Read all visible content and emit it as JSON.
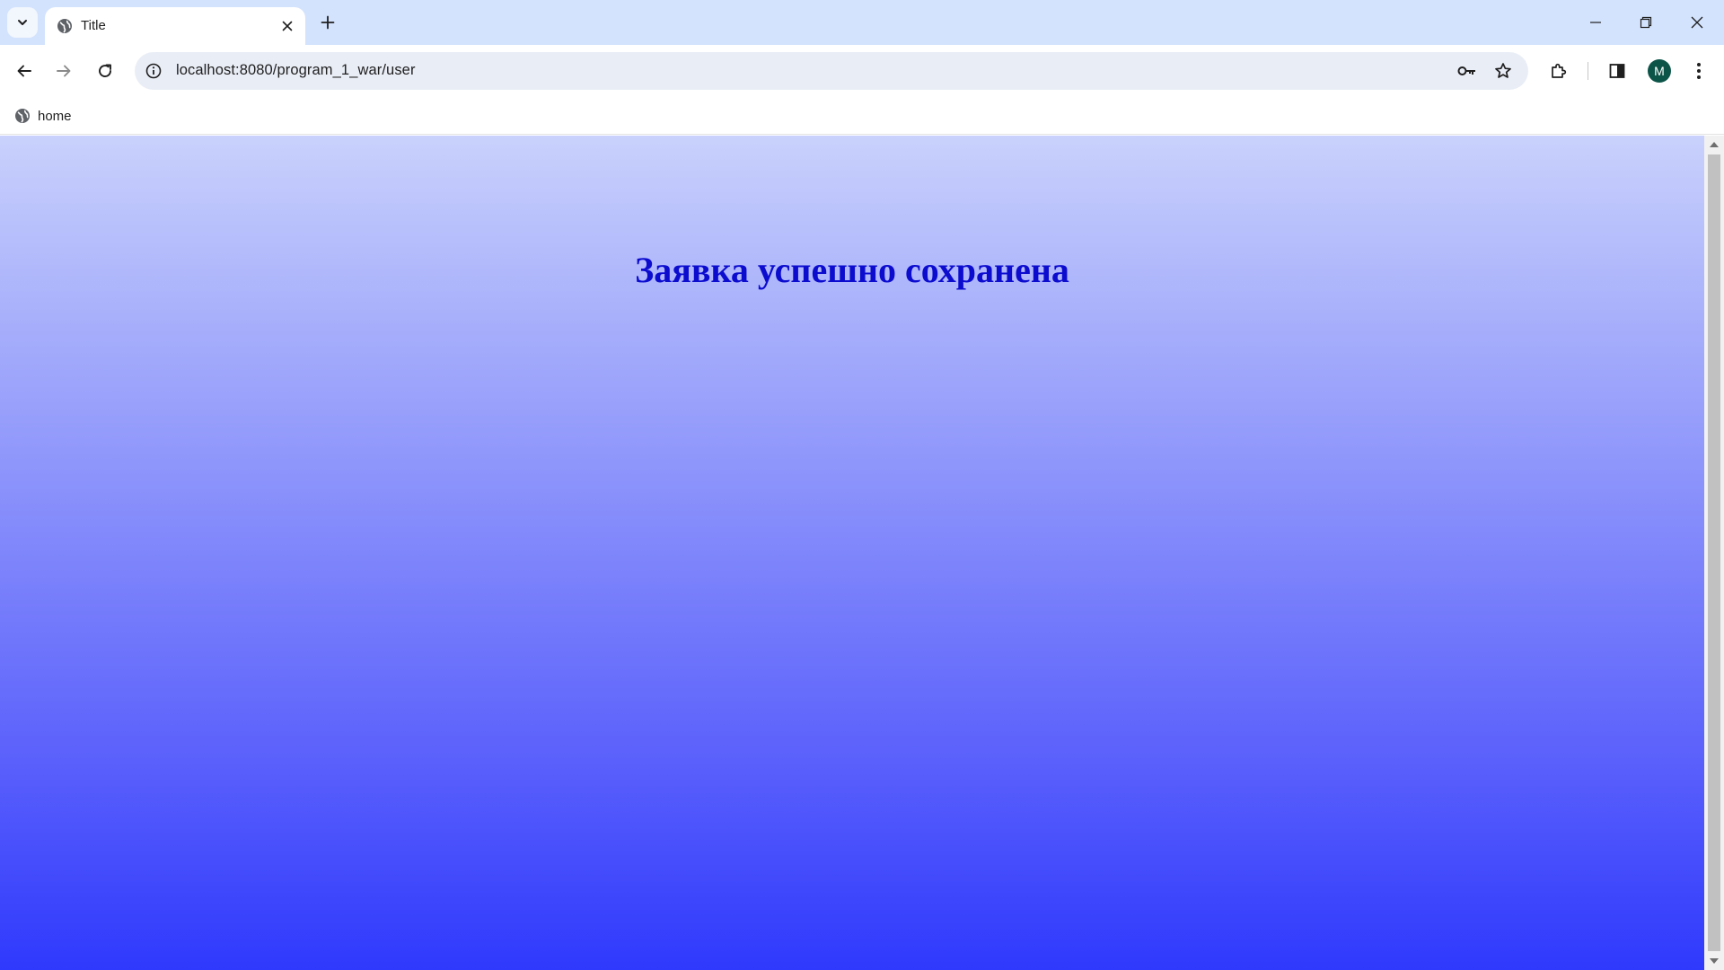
{
  "browser": {
    "tab": {
      "title": "Title",
      "favicon": "globe-icon"
    },
    "address_bar": {
      "url": "localhost:8080/program_1_war/user",
      "site_info_icon": "info-icon"
    },
    "profile": {
      "initial": "M",
      "color": "#0d5448"
    },
    "bookmarks": [
      {
        "label": "home",
        "icon": "globe-icon"
      }
    ]
  },
  "page": {
    "heading": "Заявка успешно сохранена",
    "heading_color": "#0c0ccf",
    "gradient": [
      "#c9d1fc",
      "#2f39fd"
    ]
  }
}
